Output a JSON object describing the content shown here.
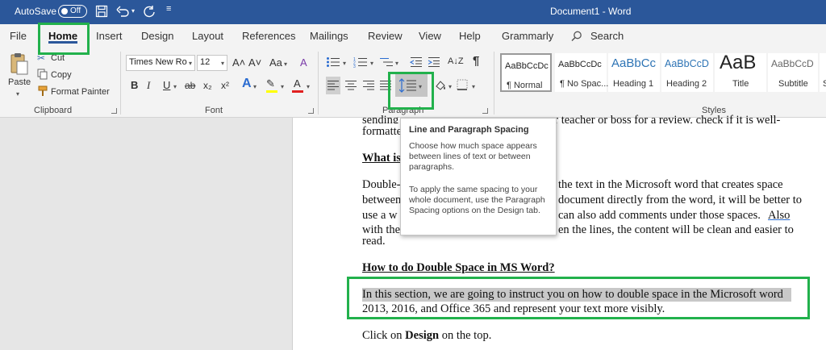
{
  "titlebar": {
    "autosave_label": "AutoSave",
    "autosave_state": "Off",
    "quick_access_more": "≡",
    "document_title": "Document1 - Word"
  },
  "tabs": [
    {
      "label": "File"
    },
    {
      "label": "Home",
      "active": true
    },
    {
      "label": "Insert"
    },
    {
      "label": "Design"
    },
    {
      "label": "Layout"
    },
    {
      "label": "References"
    },
    {
      "label": "Mailings"
    },
    {
      "label": "Review"
    },
    {
      "label": "View"
    },
    {
      "label": "Help"
    },
    {
      "label": "Grammarly"
    }
  ],
  "search": {
    "label": "Search"
  },
  "clipboard": {
    "paste": "Paste",
    "cut": "Cut",
    "copy": "Copy",
    "format_painter": "Format Painter",
    "group_label": "Clipboard"
  },
  "font": {
    "family": "Times New Ro",
    "size": "12",
    "grow": "A˄",
    "shrink": "A˅",
    "case": "Aa",
    "clear": "A",
    "bold": "B",
    "italic": "I",
    "underline": "U",
    "strike": "ab",
    "subscript": "x₂",
    "superscript": "x²",
    "effects": "A",
    "highlight": "✎",
    "color": "A",
    "group_label": "Font",
    "highlight_color": "#ffff00",
    "font_color": "#e02020"
  },
  "paragraph": {
    "group_label": "Paragraph",
    "pilcrow": "¶",
    "sort": "A↓Z"
  },
  "styles": {
    "group_label": "Styles",
    "items": [
      {
        "preview": "AaBbCcDc",
        "name": "¶ Normal"
      },
      {
        "preview": "AaBbCcDc",
        "name": "¶ No Spac..."
      },
      {
        "preview": "AaBbCc",
        "name": "Heading 1"
      },
      {
        "preview": "AaBbCcD",
        "name": "Heading 2"
      },
      {
        "preview": "AaB",
        "name": "Title"
      },
      {
        "preview": "AaBbCcD",
        "name": "Subtitle"
      },
      {
        "preview": "",
        "name": "S"
      }
    ]
  },
  "tooltip": {
    "title": "Line and Paragraph Spacing",
    "p1": "Choose how much space appears between lines of text or between paragraphs.",
    "p2": "To apply the same spacing to your whole document, use the Paragraph Spacing options on the Design tab."
  },
  "document": {
    "line1_a": "sending",
    "line1_b": "ur teacher or boss for a review, check if it is well-",
    "line2": "formatte",
    "h1": "What is",
    "p1_l1_a": "Double-",
    "p1_l1_b": "the text in the Microsoft word that creates space",
    "p1_l2_a": "between",
    "p1_l2_b": "document directly from the word, it will be better to",
    "p1_l3_a": "use a w",
    "p1_l3_b": "can also add comments under those spaces.",
    "p1_l3_c": "Also",
    "p1_l4_a": "with the",
    "p1_l4_b": "en the lines, the content will be clean and easier to",
    "p1_l5": "read.",
    "h2": "How to do Double Space in MS Word?",
    "p2_l1": "In this section, we are going to instruct you on how to double space in the Microsoft word",
    "p2_l2": "2013, 2016, and Office 365 and represent your text more visibly.",
    "p3_a": "Click on",
    "p3_b": "Design",
    "p3_c": "on the top."
  },
  "colors": {
    "title_bar": "#2b579a",
    "ribbon_bg": "#f3f3f3",
    "highlight_box": "#22b14c",
    "text_highlight": "#c8c8c8"
  }
}
